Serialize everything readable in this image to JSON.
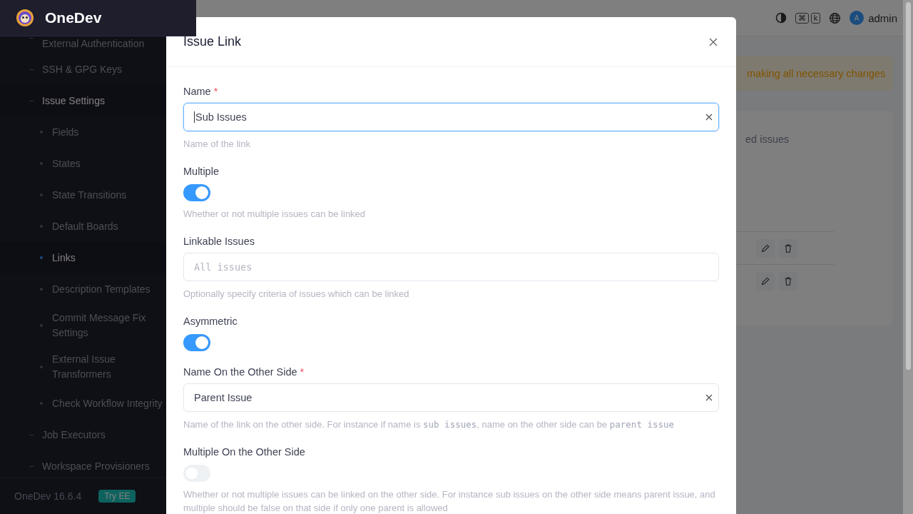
{
  "app": {
    "name": "OneDev",
    "version": "OneDev 16.6.4",
    "try_button": "Try EE"
  },
  "sidebar": {
    "items": [
      {
        "label": "External Authentication",
        "selected": false
      },
      {
        "label": "SSH & GPG Keys",
        "selected": false
      },
      {
        "label": "Issue Settings",
        "selected": false,
        "expanded": true,
        "children": [
          {
            "label": "Fields",
            "selected": false
          },
          {
            "label": "States",
            "selected": false
          },
          {
            "label": "State Transitions",
            "selected": false
          },
          {
            "label": "Default Boards",
            "selected": false
          },
          {
            "label": "Links",
            "selected": true
          },
          {
            "label": "Description Templates",
            "selected": false
          },
          {
            "label": "Commit Message Fix Settings",
            "selected": false
          },
          {
            "label": "External Issue Transformers",
            "selected": false
          },
          {
            "label": "Check Workflow Integrity",
            "selected": false
          }
        ]
      },
      {
        "label": "Job Executors",
        "selected": false
      },
      {
        "label": "Workspace Provisioners",
        "selected": false
      }
    ]
  },
  "topbar": {
    "shortcut_keys": [
      "⌘",
      "k"
    ],
    "avatar": "A",
    "user": "admin"
  },
  "background": {
    "alert": "making all necessary changes",
    "card_text": "ed issues"
  },
  "dialog": {
    "title": "Issue Link",
    "fields": [
      {
        "kind": "text",
        "label": "Name",
        "required_mark": "*",
        "value": "Sub Issues",
        "focused": true,
        "help": [
          {
            "kind": "text",
            "text": "Name of the link"
          }
        ]
      },
      {
        "kind": "toggle",
        "label": "Multiple",
        "on": true,
        "help": [
          {
            "kind": "text",
            "text": "Whether or not multiple issues can be linked"
          }
        ]
      },
      {
        "kind": "query",
        "label": "Linkable Issues",
        "placeholder": "All issues",
        "help": [
          {
            "kind": "text",
            "text": "Optionally specify criteria of issues which can be linked"
          }
        ]
      },
      {
        "kind": "toggle",
        "label": "Asymmetric",
        "on": true
      },
      {
        "kind": "text",
        "label": "Name On the Other Side",
        "required_mark": "*",
        "value": "Parent Issue",
        "focused": false,
        "help": [
          {
            "kind": "text",
            "text": "Name of the link on the other side. For instance if name is "
          },
          {
            "kind": "code",
            "text": "sub issues"
          },
          {
            "kind": "text",
            "text": ", name on the other side can be "
          },
          {
            "kind": "code",
            "text": "parent issue"
          }
        ]
      },
      {
        "kind": "toggle",
        "label": "Multiple On the Other Side",
        "on": false,
        "help": [
          {
            "kind": "text",
            "text": "Whether or not multiple issues can be linked on the other side. For instance sub issues on the other side means parent issue, and multiple should be false on that side if only one parent is allowed"
          }
        ]
      }
    ]
  }
}
